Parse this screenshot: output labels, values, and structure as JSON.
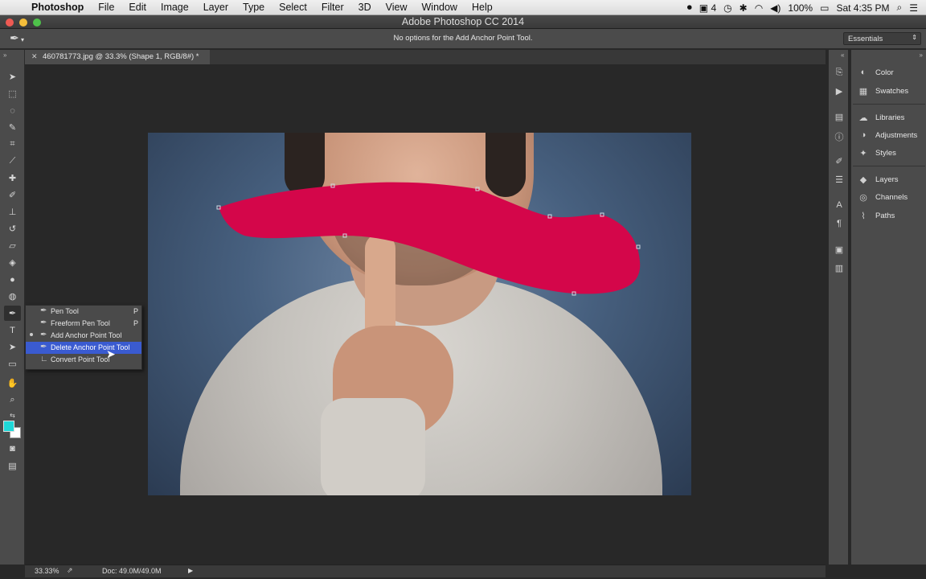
{
  "menubar": {
    "apple": "",
    "app_name": "Photoshop",
    "menus": [
      "File",
      "Edit",
      "Image",
      "Layer",
      "Type",
      "Select",
      "Filter",
      "3D",
      "View",
      "Window",
      "Help"
    ],
    "status": {
      "badge": "4",
      "battery": "100%",
      "clock": "Sat 4:35 PM"
    }
  },
  "window": {
    "title": "Adobe Photoshop CC 2014"
  },
  "options_bar": {
    "message": "No options for the Add Anchor Point Tool.",
    "workspace": "Essentials"
  },
  "document": {
    "tab_title": "460781773.jpg @ 33.3% (Shape 1, RGB/8#) *",
    "shape_color": "#d4064a"
  },
  "tool_flyout": {
    "items": [
      {
        "label": "Pen Tool",
        "shortcut": "P",
        "icon": "pen-icon",
        "selected": false,
        "active": false
      },
      {
        "label": "Freeform Pen Tool",
        "shortcut": "P",
        "icon": "freeform-pen-icon",
        "selected": false,
        "active": false
      },
      {
        "label": "Add Anchor Point Tool",
        "shortcut": "",
        "icon": "add-anchor-point-icon",
        "selected": false,
        "active": true
      },
      {
        "label": "Delete Anchor Point Tool",
        "shortcut": "",
        "icon": "delete-anchor-point-icon",
        "selected": true,
        "active": false
      },
      {
        "label": "Convert Point Tool",
        "shortcut": "",
        "icon": "convert-point-icon",
        "selected": false,
        "active": false
      }
    ]
  },
  "colors": {
    "foreground": "#1fd8d8",
    "background": "#ffffff"
  },
  "status_bar": {
    "zoom": "33.33%",
    "doc_size": "Doc: 49.0M/49.0M"
  },
  "panels": {
    "groups": [
      [
        {
          "label": "Color",
          "icon": "color-icon"
        },
        {
          "label": "Swatches",
          "icon": "swatches-icon"
        }
      ],
      [
        {
          "label": "Libraries",
          "icon": "libraries-icon"
        },
        {
          "label": "Adjustments",
          "icon": "adjustments-icon"
        },
        {
          "label": "Styles",
          "icon": "styles-icon"
        }
      ],
      [
        {
          "label": "Layers",
          "icon": "layers-icon"
        },
        {
          "label": "Channels",
          "icon": "channels-icon"
        },
        {
          "label": "Paths",
          "icon": "paths-icon"
        }
      ]
    ]
  }
}
